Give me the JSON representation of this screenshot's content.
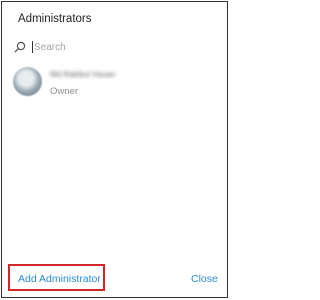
{
  "dialog": {
    "title": "Administrators",
    "search": {
      "placeholder": "Search",
      "icon": "search-icon"
    },
    "administrators": [
      {
        "name": "Md.Rakibul Hasan",
        "role": "Owner"
      }
    ],
    "footer": {
      "add_label": "Add Administrator",
      "close_label": "Close"
    },
    "colors": {
      "accent": "#2a8cd9",
      "highlight": "#d2262b"
    }
  }
}
